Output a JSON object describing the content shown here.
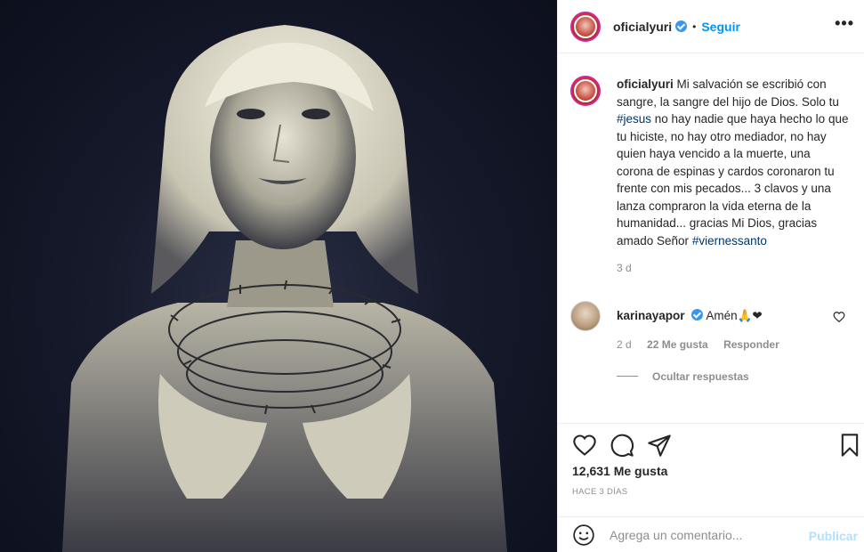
{
  "post": {
    "image_alt": "Black and white portrait holding a crown of thorns",
    "author": "oficialyuri",
    "verified": true,
    "follow_label": "Seguir",
    "more_label": "•••"
  },
  "caption": {
    "username": "oficialyuri",
    "text_before": " Mi salvación se escribió con sangre, la sangre del hijo de Dios. Solo tu ",
    "hashtag1": "#jesus",
    "text_middle": " no hay nadie que haya hecho lo que tu hiciste, no hay otro mediador, no hay quien haya vencido a la muerte, una corona de espinas y cardos coronaron tu frente con mis pecados... 3 clavos y una lanza compraron la vida eterna de la humanidad... gracias Mi Dios, gracias amado Señor ",
    "hashtag2": "#viernessanto",
    "time": "3 d"
  },
  "comment": {
    "username": "karinayapor",
    "text": "Amén🙏❤",
    "time": "2 d",
    "likes": "22 Me gusta",
    "reply_label": "Responder",
    "hide_replies": "Ocultar respuestas"
  },
  "stats": {
    "likes": "12,631 Me gusta",
    "time_ago": "HACE 3 DÍAS"
  },
  "composer": {
    "placeholder": "Agrega un comentario...",
    "publish_label": "Publicar"
  },
  "icons": {
    "like": "heart-icon",
    "comment": "comment-icon",
    "share": "share-icon",
    "save": "bookmark-icon",
    "emoji": "emoji-icon"
  },
  "colors": {
    "accent": "#0095f6",
    "verified": "#3897f0",
    "muted": "#8e8e8e",
    "publish_disabled": "#b2dffc"
  }
}
